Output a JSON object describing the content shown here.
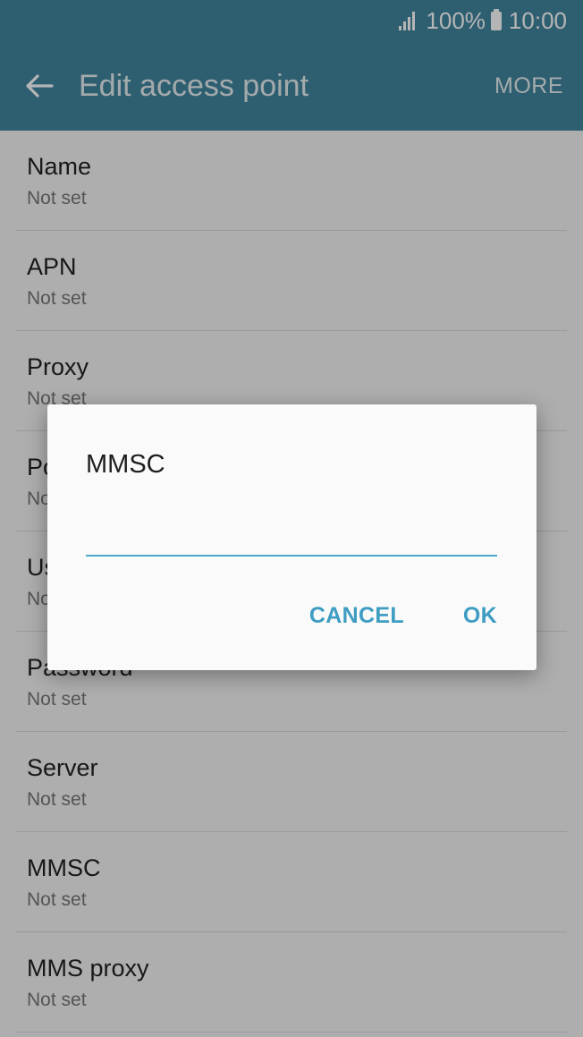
{
  "status_bar": {
    "battery_percent": "100%",
    "time": "10:00"
  },
  "app_bar": {
    "title": "Edit access point",
    "more_label": "MORE"
  },
  "settings": [
    {
      "title": "Name",
      "value": "Not set"
    },
    {
      "title": "APN",
      "value": "Not set"
    },
    {
      "title": "Proxy",
      "value": "Not set"
    },
    {
      "title": "Port",
      "value": "Not set"
    },
    {
      "title": "Username",
      "value": "Not set"
    },
    {
      "title": "Password",
      "value": "Not set"
    },
    {
      "title": "Server",
      "value": "Not set"
    },
    {
      "title": "MMSC",
      "value": "Not set"
    },
    {
      "title": "MMS proxy",
      "value": "Not set"
    }
  ],
  "dialog": {
    "title": "MMSC",
    "input_value": "",
    "cancel_label": "CANCEL",
    "ok_label": "OK"
  },
  "colors": {
    "accent": "#40869f",
    "button": "#3e9dc2",
    "input_line": "#4aa7c9"
  }
}
